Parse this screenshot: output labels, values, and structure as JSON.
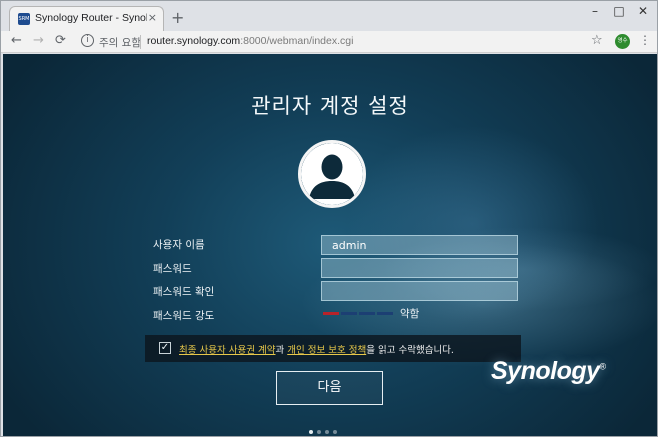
{
  "browser": {
    "tab": {
      "title": "Synology Router - SynologyRou",
      "favicon_text": "SRM",
      "close": "×"
    },
    "new_tab": "+",
    "window_controls": {
      "minimize": "–",
      "maximize": "□",
      "close": "✕"
    },
    "nav": {
      "back": "←",
      "forward": "→",
      "reload": "⟳"
    },
    "security_label": "주의 요함",
    "url": {
      "host": "router.synology.com",
      "path": ":8000/webman/index.cgi"
    },
    "bookmark": "☆",
    "profile_initials": "영수",
    "menu": "⋮"
  },
  "page": {
    "title": "관리자 계정 설정",
    "fields": {
      "username_label": "사용자 이름",
      "username_value": "admin",
      "password_label": "패스워드",
      "password_confirm_label": "패스워드 확인",
      "strength_label": "패스워드 강도",
      "strength_value": "약함"
    },
    "strength_level": 1,
    "strength_segments": 4,
    "agreement": {
      "checked": true,
      "link1": "최종 사용자 사용권 계약",
      "mid": "과 ",
      "link2": "개인 정보 보호 정책",
      "end": "을 읽고 수락했습니다."
    },
    "next_button": "다음",
    "logo": "Synology",
    "logo_mark": "®",
    "page_dots": 4,
    "colors": {
      "strength_weak": "#b8232a",
      "strength_empty": "#1c3f73",
      "link": "#e7c84a"
    }
  }
}
